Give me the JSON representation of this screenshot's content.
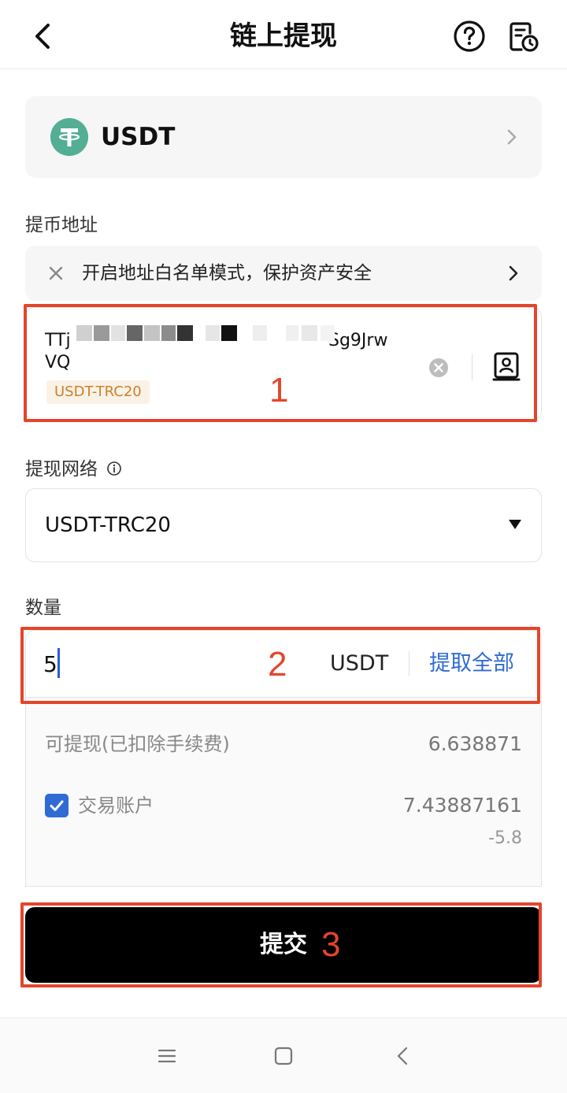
{
  "header": {
    "title": "链上提现"
  },
  "coin": {
    "symbol": "USDT",
    "logo_color": "#53ae94"
  },
  "address_section": {
    "label": "提币地址",
    "whitelist_banner": "开启地址白名单模式，保护资产安全",
    "address_line1": "TTj",
    "address_line1_tail": "Sg9Jrw",
    "address_line2": "VQ",
    "network_tag": "USDT-TRC20"
  },
  "network_section": {
    "label": "提现网络",
    "selected": "USDT-TRC20"
  },
  "amount_section": {
    "label": "数量",
    "value": "5",
    "unit": "USDT",
    "max_label": "提取全部"
  },
  "details": {
    "available_label": "可提现(已扣除手续费)",
    "available_value": "6.638871",
    "account_label": "交易账户",
    "account_value": "7.43887161",
    "account_change": "-5.8",
    "account_checked": true
  },
  "submit": {
    "label": "提交"
  },
  "annotations": {
    "step1": "1",
    "step2": "2",
    "step3": "3",
    "color": "#e3452c"
  },
  "colors": {
    "accent_blue": "#2f6bd3",
    "tag_orange": "#c9822f"
  }
}
